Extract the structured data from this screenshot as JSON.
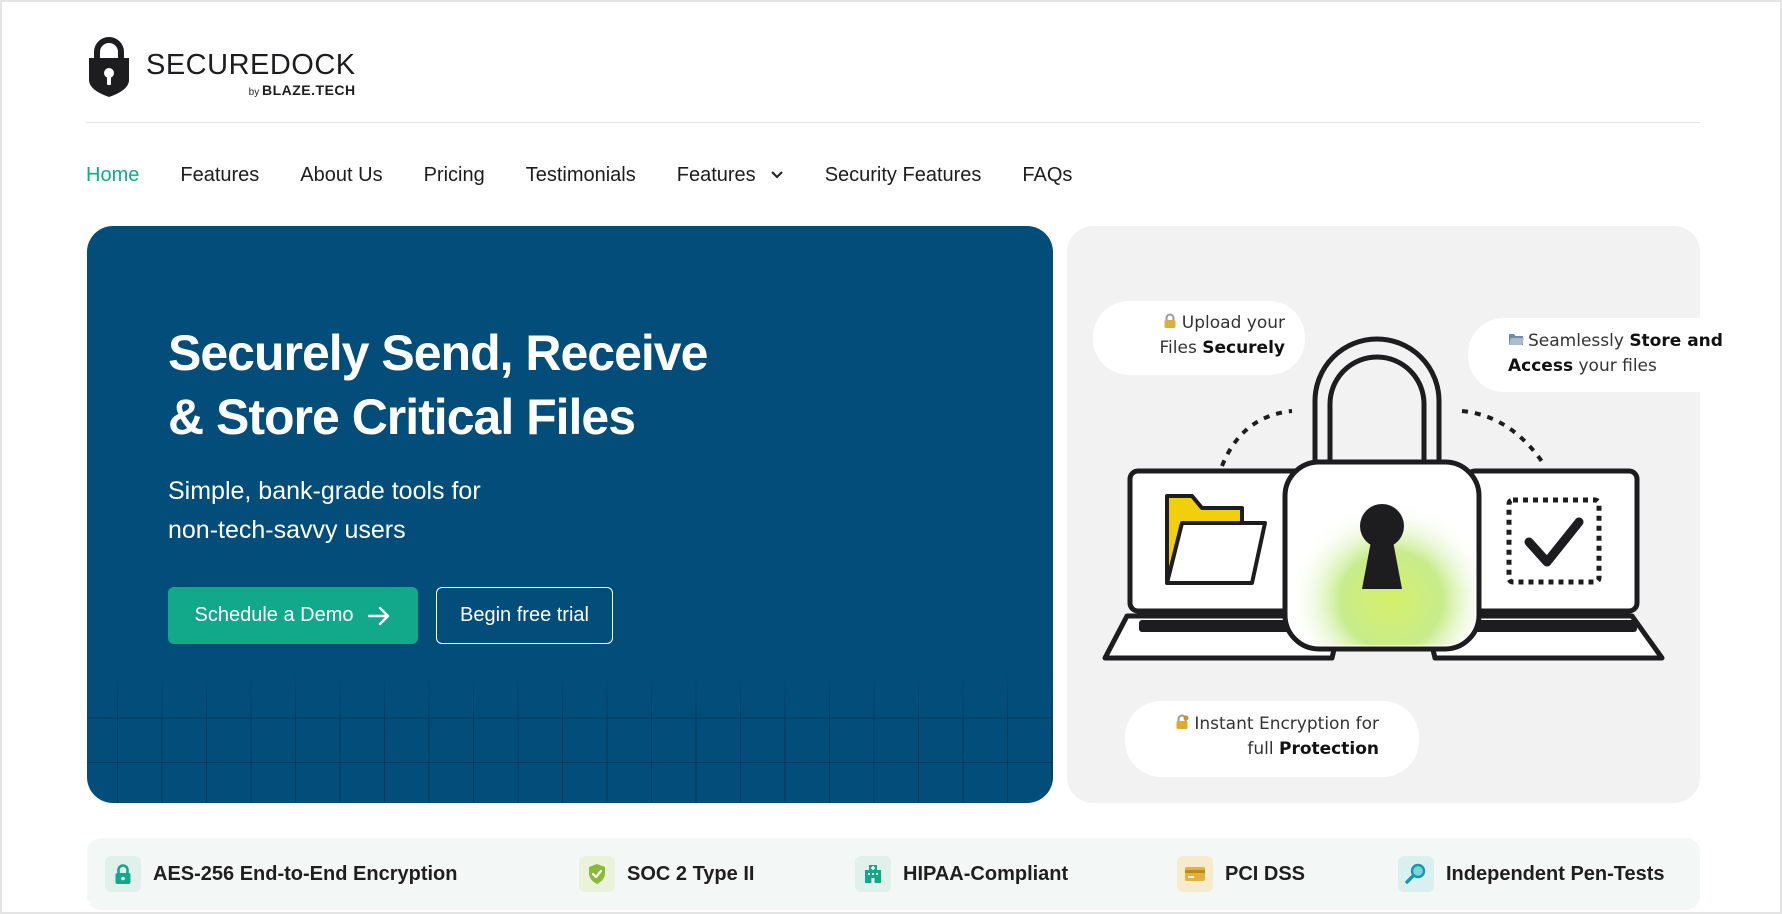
{
  "brand": {
    "name": "SECUREDOCK",
    "by_prefix": "by",
    "by_company": "BLAZE.TECH"
  },
  "nav": {
    "items": [
      {
        "label": "Home",
        "active": true
      },
      {
        "label": "Features"
      },
      {
        "label": "About Us"
      },
      {
        "label": "Pricing"
      },
      {
        "label": "Testimonials"
      },
      {
        "label": "Features",
        "has_dropdown": true
      },
      {
        "label": "Security Features"
      },
      {
        "label": "FAQs"
      }
    ]
  },
  "hero": {
    "title_line1": "Securely Send, Receive",
    "title_line2": "& Store Critical Files",
    "subtitle_line1": "Simple, bank-grade tools for",
    "subtitle_line2": "non-tech-savvy users",
    "primary_cta": "Schedule a Demo",
    "secondary_cta": "Begin free trial"
  },
  "illustration": {
    "bubble_upload": {
      "line1": "Upload your",
      "line2_pre": "Files ",
      "line2_bold": "Securely"
    },
    "bubble_store": {
      "line1_pre": "Seamlessly ",
      "line1_bold": "Store and",
      "line2_bold": "Access",
      "line2_post": " your files"
    },
    "bubble_encrypt": {
      "line1": "Instant Encryption for",
      "line2_pre": "full ",
      "line2_bold": "Protection"
    }
  },
  "compliance": [
    {
      "label": "AES-256 End-to-End Encryption",
      "icon": "lock-icon"
    },
    {
      "label": "SOC 2 Type II",
      "icon": "shield-icon"
    },
    {
      "label": "HIPAA-Compliant",
      "icon": "hospital-icon"
    },
    {
      "label": "PCI DSS",
      "icon": "card-icon"
    },
    {
      "label": "Independent Pen-Tests",
      "icon": "magnifier-icon"
    }
  ],
  "colors": {
    "accent": "#12a98b",
    "hero_bg": "#034d7a",
    "panel_bg": "#f1f2f1",
    "strip_bg": "#f3f7f6"
  }
}
